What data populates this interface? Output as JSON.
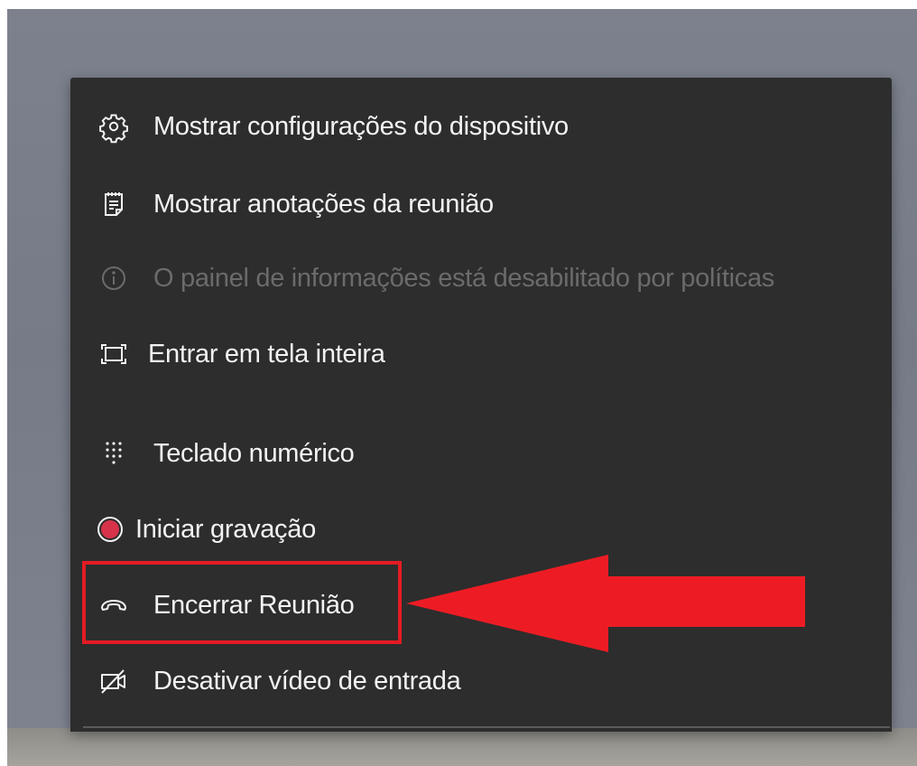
{
  "menu": {
    "items": [
      {
        "label": "Mostrar configurações do dispositivo",
        "icon": "gear-icon",
        "disabled": false
      },
      {
        "label": "Mostrar anotações da reunião",
        "icon": "notes-icon",
        "disabled": false
      },
      {
        "label": "O painel de informações está desabilitado por políticas",
        "icon": "info-icon",
        "disabled": true
      },
      {
        "label": "Entrar em tela inteira",
        "icon": "fullscreen-icon",
        "disabled": false
      },
      {
        "label": "Teclado numérico",
        "icon": "dialpad-icon",
        "disabled": false
      },
      {
        "label": "Iniciar gravação",
        "icon": "record-icon",
        "disabled": false
      },
      {
        "label": "Encerrar Reunião",
        "icon": "hang-up-icon",
        "disabled": false
      },
      {
        "label": "Desativar vídeo de entrada",
        "icon": "video-off-icon",
        "disabled": false
      }
    ]
  },
  "annotation": {
    "highlight_color": "#e41b23",
    "arrow_color": "#ed1c24",
    "highlighted_item": "Encerrar Reunião"
  },
  "colors": {
    "menu_background": "#2d2d2d",
    "text": "#f3f3f3",
    "disabled_text": "#6b6b6b",
    "record_red": "#d6334a"
  }
}
